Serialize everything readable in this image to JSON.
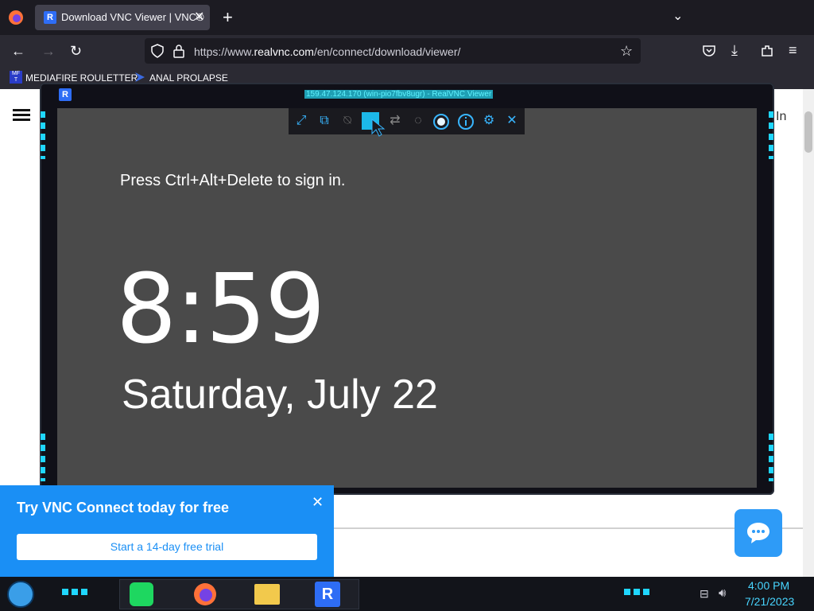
{
  "browser": {
    "tab_title": "Download VNC Viewer | VNC®",
    "tab_close": "✕",
    "new_tab": "+",
    "url_prefix": "https://www.",
    "url_domain": "realvnc.com",
    "url_path": "/en/connect/download/viewer/",
    "bookmarks": [
      {
        "label": "MEDIAFIRE ROULETTER"
      },
      {
        "label": "ANAL PROLAPSE"
      }
    ]
  },
  "page": {
    "signin_fragment": "In",
    "promo_title": "Try VNC Connect today for free",
    "promo_button": "Start a 14-day free trial",
    "promo_close": "✕"
  },
  "vnc": {
    "title": "159.47.124.170 (win-pio7fbv8ugr) - RealVNC Viewer",
    "lock_message": "Press Ctrl+Alt+Delete to sign in.",
    "lock_time": "8:59",
    "lock_date": "Saturday, July 22",
    "toolbar_icons": [
      "fullscreen-icon",
      "scale-icon",
      "audio-mute-icon",
      "send-keys-icon",
      "transfer-icon",
      "chat-icon",
      "record-icon",
      "info-icon",
      "settings-icon",
      "close-icon"
    ]
  },
  "taskbar": {
    "time": "4:00 PM",
    "date": "7/21/2023"
  },
  "colors": {
    "accent": "#1a8ff5",
    "vnc_icon": "#38b6ff",
    "tray_text": "#48d5ff"
  }
}
